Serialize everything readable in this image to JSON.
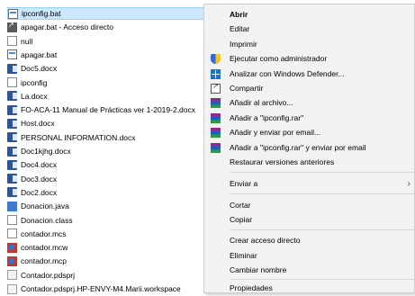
{
  "files": [
    {
      "name": "ipconfig.bat",
      "icon": "bat-file-icon",
      "selected": true
    },
    {
      "name": "apagar.bat - Acceso directo",
      "icon": "shortcut-icon"
    },
    {
      "name": "null",
      "icon": "blank-file-icon"
    },
    {
      "name": "apagar.bat",
      "icon": "bat-file-icon"
    },
    {
      "name": "Doc5.docx",
      "icon": "word-doc-icon"
    },
    {
      "name": "ipconfig",
      "icon": "blank-file-icon"
    },
    {
      "name": "La.docx",
      "icon": "word-doc-icon"
    },
    {
      "name": "FO-ACA-11 Manual de Prácticas ver 1-2019-2.docx",
      "icon": "word-doc-icon"
    },
    {
      "name": "Host.docx",
      "icon": "word-doc-icon"
    },
    {
      "name": "PERSONAL INFORMATION.docx",
      "icon": "word-doc-icon"
    },
    {
      "name": "Doc1kjhg.docx",
      "icon": "word-doc-icon"
    },
    {
      "name": "Doc4.docx",
      "icon": "word-doc-icon"
    },
    {
      "name": "Doc3.docx",
      "icon": "word-doc-icon"
    },
    {
      "name": "Doc2.docx",
      "icon": "word-doc-icon"
    },
    {
      "name": "Donacion.java",
      "icon": "java-file-icon"
    },
    {
      "name": "Donacion.class",
      "icon": "blank-file-icon"
    },
    {
      "name": "contador.mcs",
      "icon": "blank-file-icon"
    },
    {
      "name": "contador.mcw",
      "icon": "mathcad-icon"
    },
    {
      "name": "contador.mcp",
      "icon": "mathcad-icon"
    },
    {
      "name": "Contador.pdsprj",
      "icon": "proteus-file-icon"
    },
    {
      "name": "Contador.pdsprj.HP-ENVY-M4.Marii.workspace",
      "icon": "proteus-file-icon"
    }
  ],
  "menu": {
    "open": "Abrir",
    "edit": "Editar",
    "print": "Imprimir",
    "run_as_admin": "Ejecutar como administrador",
    "scan_defender": "Analizar con Windows Defender...",
    "share": "Compartir",
    "add_archive": "Añadir al archivo...",
    "add_rar": "Añadir a \"ipconfig.rar\"",
    "compress_email": "Añadir y enviar por email...",
    "add_rar_email": "Añadir a \"ipconfig.rar\" y enviar por email",
    "restore_versions": "Restaurar versiones anteriores",
    "send_to": "Enviar a",
    "cut": "Cortar",
    "copy": "Copiar",
    "create_shortcut": "Crear acceso directo",
    "delete": "Eliminar",
    "rename": "Cambiar nombre",
    "properties": "Propiedades"
  },
  "colors": {
    "selection": "#cce8ff",
    "menu_bg": "#f2f2f2",
    "word_blue": "#2b579a"
  }
}
